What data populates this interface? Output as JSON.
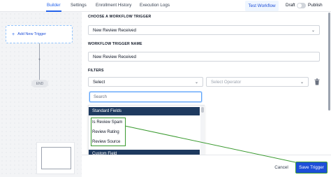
{
  "nav": {
    "tabs": [
      {
        "label": "Builder"
      },
      {
        "label": "Settings"
      },
      {
        "label": "Enrollment History"
      },
      {
        "label": "Execution Logs"
      }
    ],
    "test_workflow": "Test Workflow",
    "draft": "Draft",
    "publish": "Publish",
    "publish_on": false
  },
  "canvas": {
    "add_trigger": "Add New Trigger",
    "end": "END"
  },
  "panel": {
    "choose_trigger_label": "CHOOSE A WORKFLOW TRIGGER",
    "trigger_value": "New Review Received",
    "trigger_name_label": "WORKFLOW TRIGGER NAME",
    "trigger_name_value": "New Review Received",
    "filters_label": "FILTERS",
    "filter_select": "Select",
    "operator_placeholder": "Select Operator",
    "search_placeholder": "Search",
    "dropdown": {
      "group_standard": "Standard Fields",
      "items": [
        {
          "label": "Is Review Spam"
        },
        {
          "label": "Review Rating"
        },
        {
          "label": "Review Source"
        }
      ],
      "group_custom": "Custom Field"
    }
  },
  "footer": {
    "cancel": "Cancel",
    "save": "Save Trigger"
  },
  "colors": {
    "accent": "#2563eb",
    "header_dark": "#1e3a5f",
    "annotation_green": "#3a9a2f"
  },
  "icons": [
    "plus-icon",
    "chevron-down-icon",
    "trash-icon",
    "toggle-switch"
  ]
}
